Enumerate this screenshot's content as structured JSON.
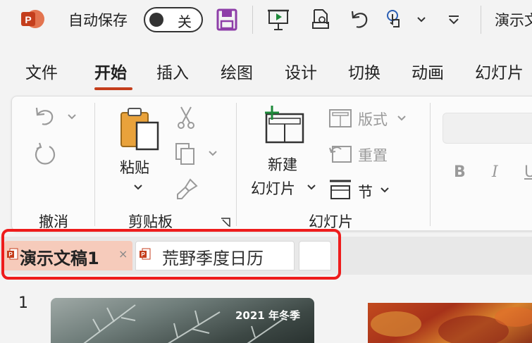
{
  "titlebar": {
    "autosave_label": "自动保存",
    "toggle_state": "关",
    "doc_title": "演示文"
  },
  "icons": {
    "app": "powerpoint-logo",
    "save": "save-icon",
    "present": "present-from-start-icon",
    "print": "print-preview-icon",
    "undo": "undo-icon",
    "touch": "touch-mode-icon",
    "customize": "customize-quick-access-icon"
  },
  "menu": {
    "tabs": [
      "文件",
      "开始",
      "插入",
      "绘图",
      "设计",
      "切换",
      "动画",
      "幻灯片"
    ],
    "active": "开始"
  },
  "ribbon": {
    "undo_group": "撤消",
    "clipboard_group": "剪贴板",
    "paste": "粘贴",
    "slides_group": "幻灯片",
    "new_slide_line1": "新建",
    "new_slide_line2": "幻灯片",
    "layout": "版式",
    "reset": "重置",
    "section": "节",
    "bold": "B",
    "italic": "I",
    "underline": "U"
  },
  "doc_tabs": {
    "active_label": "演示文稿1",
    "close_glyph": "×",
    "second_label": "荒野季度日历"
  },
  "slides": {
    "first_number": "1",
    "thumb_text": "2021 年冬季"
  },
  "colors": {
    "accent": "#c43e1c",
    "active_tab_bg": "#f6cbbb",
    "highlight_border": "#ee1c1c",
    "save_icon": "#8e3ea8"
  }
}
